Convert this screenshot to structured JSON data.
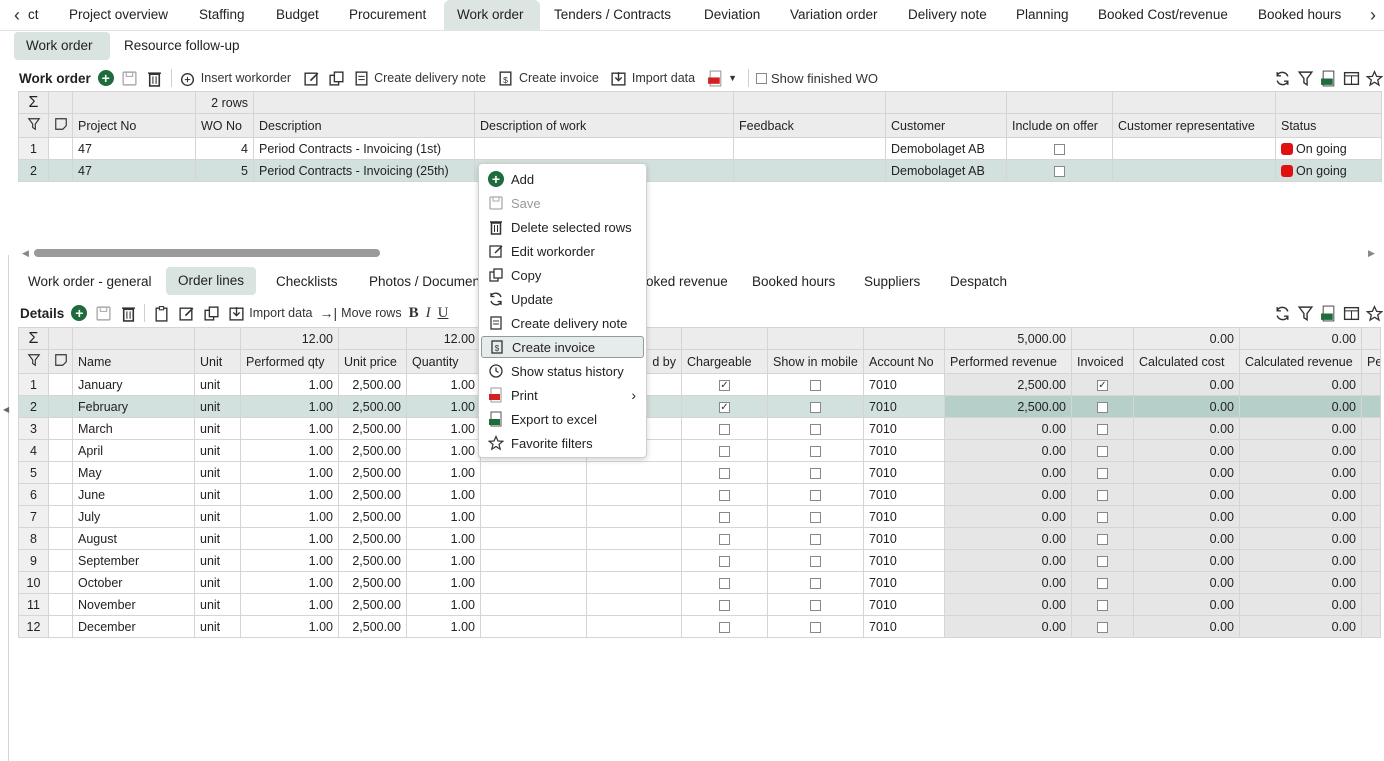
{
  "topnav": {
    "back_label": "ct",
    "tabs": [
      "Project overview",
      "Staffing",
      "Budget",
      "Procurement",
      "Work order",
      "Tenders / Contracts",
      "Deviation",
      "Variation order",
      "Delivery note",
      "Planning",
      "Booked Cost/revenue",
      "Booked hours"
    ],
    "active": "Work order"
  },
  "subtabs": [
    "Work order",
    "Resource follow-up"
  ],
  "wo_toolbar": {
    "title": "Work order",
    "insert": "Insert workorder",
    "delivery": "Create delivery note",
    "invoice": "Create invoice",
    "import": "Import data",
    "show_finished": "Show finished WO"
  },
  "wo_grid": {
    "row_count": "2 rows",
    "headers": [
      "Project No",
      "WO No",
      "Description",
      "Description of work",
      "Feedback",
      "Customer",
      "Include on offer",
      "Customer representative",
      "Status"
    ],
    "rows": [
      {
        "n": "1",
        "project": "47",
        "wo": "4",
        "desc": "Period Contracts - Invoicing (1st)",
        "customer": "Demobolaget AB",
        "status": "On going"
      },
      {
        "n": "2",
        "project": "47",
        "wo": "5",
        "desc": "Period Contracts - Invoicing (25th)",
        "customer": "Demobolaget AB",
        "status": "On going"
      }
    ]
  },
  "detail_tabs": [
    "Work order - general",
    "Order lines",
    "Checklists",
    "Photos / Documen",
    "oked revenue",
    "Booked hours",
    "Suppliers",
    "Despatch"
  ],
  "details_toolbar": {
    "title": "Details",
    "import": "Import data",
    "move": "Move rows"
  },
  "lines_grid": {
    "sums": {
      "performed_qty": "12.00",
      "quantity": "12.00",
      "performed_revenue": "5,000.00",
      "calc_cost": "0.00",
      "calc_revenue": "0.00"
    },
    "headers": [
      "Name",
      "Unit",
      "Performed qty",
      "Unit price",
      "Quantity",
      "d by",
      "Chargeable",
      "Show in mobile",
      "Account No",
      "Performed revenue",
      "Invoiced",
      "Calculated cost",
      "Calculated revenue",
      "Pe"
    ],
    "rows": [
      {
        "n": "1",
        "name": "January",
        "unit": "unit",
        "pqty": "1.00",
        "price": "2,500.00",
        "qty": "1.00",
        "account": "7010",
        "rev": "2,500.00",
        "cost": "0.00",
        "crev": "0.00",
        "charge": true,
        "inv": true
      },
      {
        "n": "2",
        "name": "February",
        "unit": "unit",
        "pqty": "1.00",
        "price": "2,500.00",
        "qty": "1.00",
        "account": "7010",
        "rev": "2,500.00",
        "cost": "0.00",
        "crev": "0.00",
        "charge": true,
        "inv": false
      },
      {
        "n": "3",
        "name": "March",
        "unit": "unit",
        "pqty": "1.00",
        "price": "2,500.00",
        "qty": "1.00",
        "account": "7010",
        "rev": "0.00",
        "cost": "0.00",
        "crev": "0.00",
        "charge": false,
        "inv": false
      },
      {
        "n": "4",
        "name": "April",
        "unit": "unit",
        "pqty": "1.00",
        "price": "2,500.00",
        "qty": "1.00",
        "account": "7010",
        "rev": "0.00",
        "cost": "0.00",
        "crev": "0.00",
        "charge": false,
        "inv": false
      },
      {
        "n": "5",
        "name": "May",
        "unit": "unit",
        "pqty": "1.00",
        "price": "2,500.00",
        "qty": "1.00",
        "account": "7010",
        "rev": "0.00",
        "cost": "0.00",
        "crev": "0.00",
        "charge": false,
        "inv": false
      },
      {
        "n": "6",
        "name": "June",
        "unit": "unit",
        "pqty": "1.00",
        "price": "2,500.00",
        "qty": "1.00",
        "account": "7010",
        "rev": "0.00",
        "cost": "0.00",
        "crev": "0.00",
        "charge": false,
        "inv": false
      },
      {
        "n": "7",
        "name": "July",
        "unit": "unit",
        "pqty": "1.00",
        "price": "2,500.00",
        "qty": "1.00",
        "account": "7010",
        "rev": "0.00",
        "cost": "0.00",
        "crev": "0.00",
        "charge": false,
        "inv": false
      },
      {
        "n": "8",
        "name": "August",
        "unit": "unit",
        "pqty": "1.00",
        "price": "2,500.00",
        "qty": "1.00",
        "account": "7010",
        "rev": "0.00",
        "cost": "0.00",
        "crev": "0.00",
        "charge": false,
        "inv": false
      },
      {
        "n": "9",
        "name": "September",
        "unit": "unit",
        "pqty": "1.00",
        "price": "2,500.00",
        "qty": "1.00",
        "account": "7010",
        "rev": "0.00",
        "cost": "0.00",
        "crev": "0.00",
        "charge": false,
        "inv": false
      },
      {
        "n": "10",
        "name": "October",
        "unit": "unit",
        "pqty": "1.00",
        "price": "2,500.00",
        "qty": "1.00",
        "account": "7010",
        "rev": "0.00",
        "cost": "0.00",
        "crev": "0.00",
        "charge": false,
        "inv": false
      },
      {
        "n": "11",
        "name": "November",
        "unit": "unit",
        "pqty": "1.00",
        "price": "2,500.00",
        "qty": "1.00",
        "account": "7010",
        "rev": "0.00",
        "cost": "0.00",
        "crev": "0.00",
        "charge": false,
        "inv": false
      },
      {
        "n": "12",
        "name": "December",
        "unit": "unit",
        "pqty": "1.00",
        "price": "2,500.00",
        "qty": "1.00",
        "account": "7010",
        "rev": "0.00",
        "cost": "0.00",
        "crev": "0.00",
        "charge": false,
        "inv": false
      }
    ]
  },
  "context_menu": {
    "items": [
      {
        "label": "Add",
        "icon": "plus-circle-icon"
      },
      {
        "label": "Save",
        "icon": "save-icon",
        "disabled": true
      },
      {
        "label": "Delete selected rows",
        "icon": "trash-icon"
      },
      {
        "label": "Edit workorder",
        "icon": "edit-icon"
      },
      {
        "label": "Copy",
        "icon": "copy-icon"
      },
      {
        "label": "Update",
        "icon": "refresh-icon"
      },
      {
        "label": "Create delivery note",
        "icon": "delivery-note-icon"
      },
      {
        "label": "Create invoice",
        "icon": "invoice-icon",
        "highlighted": true
      },
      {
        "label": "Show status history",
        "icon": "history-icon"
      },
      {
        "label": "Print",
        "icon": "pdf-icon",
        "submenu": true
      },
      {
        "label": "Export to excel",
        "icon": "excel-icon"
      },
      {
        "label": "Favorite filters",
        "icon": "star-icon"
      }
    ]
  },
  "colors": {
    "accent": "#1e6b3c",
    "selected_row": "#d3e1de",
    "status_red": "#e01010"
  }
}
